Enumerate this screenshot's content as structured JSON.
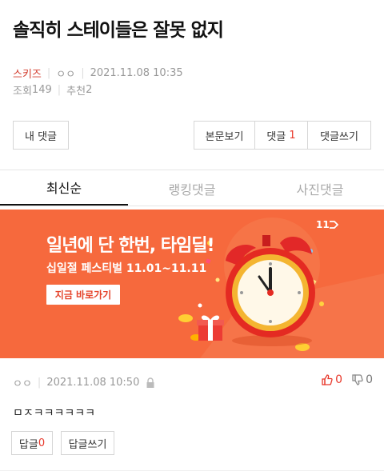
{
  "post": {
    "title": "솔직히 스테이들은 잘못 없지",
    "category": "스키즈",
    "author": "ㅇㅇ",
    "datetime": "2021.11.08 10:35",
    "views_label": "조회",
    "views": "149",
    "recommend_label": "추천",
    "recommend": "2"
  },
  "toolbar": {
    "my_comments": "내 댓글",
    "view_post": "본문보기",
    "comments_label": "댓글",
    "comments_count": "1",
    "write_comment": "댓글쓰기"
  },
  "tabs": [
    "최신순",
    "랭킹댓글",
    "사진댓글"
  ],
  "banner": {
    "logo": "11",
    "headline": "일년에 단 한번, 타임딜!",
    "subline": "십일절 페스티벌 11.01~11.11",
    "cta": "지금 바로가기",
    "bg_color": "#f6693d"
  },
  "comment": {
    "author": "ㅇㅇ",
    "datetime": "2021.11.08 10:50",
    "text": "ㅁㅈㅋㅋㅋㅋㅋㅋ",
    "up": "0",
    "down": "0",
    "reply_label": "답글",
    "reply_count": "0",
    "write_reply": "답글쓰기"
  },
  "colors": {
    "accent": "#e8392c",
    "muted": "#999999"
  },
  "icons": [
    "lock-icon",
    "thumbs-up-icon",
    "thumbs-down-icon",
    "alarm-clock-icon",
    "gift-box-icon"
  ]
}
